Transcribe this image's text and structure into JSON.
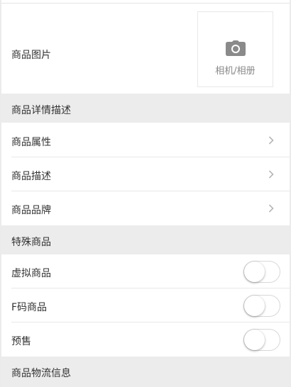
{
  "image_row": {
    "label": "商品图片",
    "upload_hint": "相机/相册"
  },
  "sections": {
    "details": "商品详情描述",
    "special": "特殊商品",
    "logistics": "商品物流信息"
  },
  "detail_rows": [
    {
      "label": "商品属性"
    },
    {
      "label": "商品描述"
    },
    {
      "label": "商品品牌"
    }
  ],
  "special_rows": [
    {
      "label": "虚拟商品",
      "enabled": false
    },
    {
      "label": "F码商品",
      "enabled": false
    },
    {
      "label": "预售",
      "enabled": false
    }
  ],
  "colors": {
    "section_bg": "#ececec",
    "icon_gray": "#8a8a8a",
    "chevron": "#b5b5b5"
  }
}
